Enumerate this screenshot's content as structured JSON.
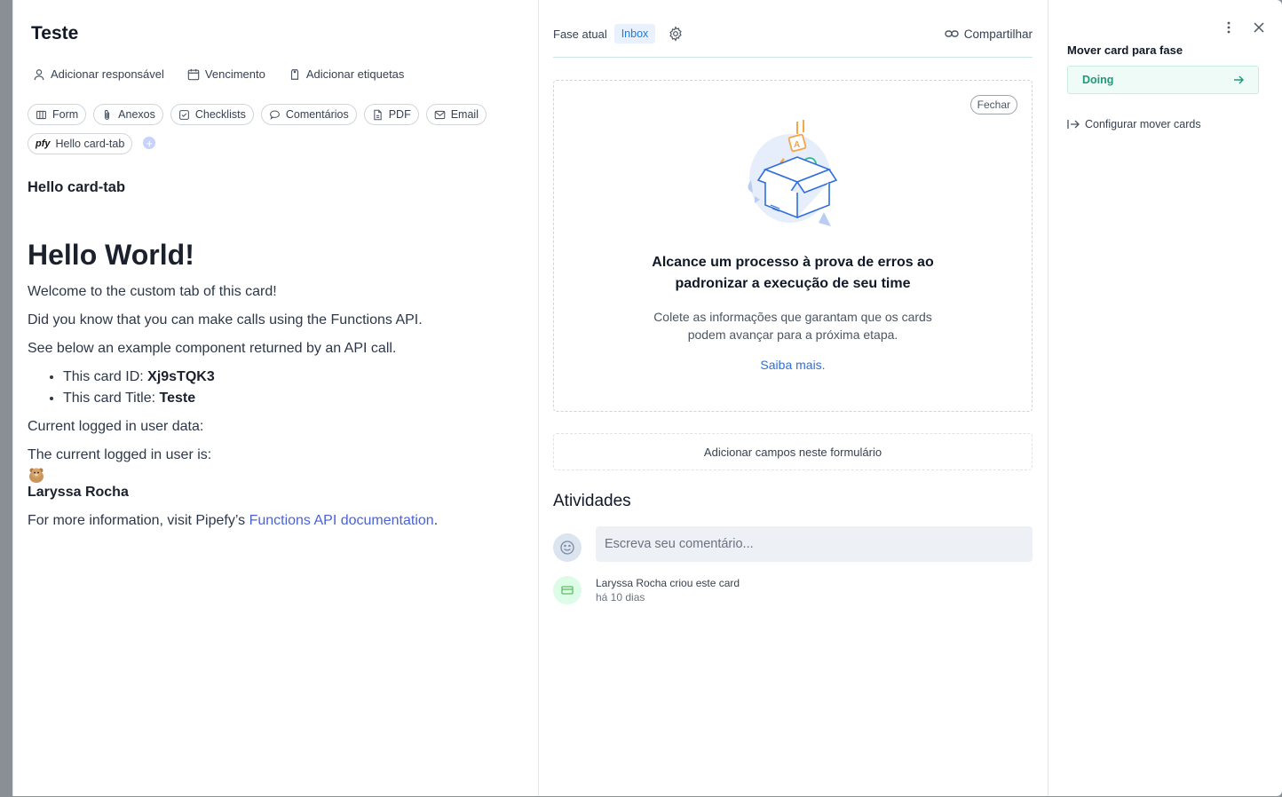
{
  "card": {
    "title": "Teste",
    "actions": {
      "assignee": "Adicionar responsável",
      "due": "Vencimento",
      "labels": "Adicionar etiquetas"
    },
    "tabs": [
      "Form",
      "Anexos",
      "Checklists",
      "Comentários",
      "PDF",
      "Email"
    ],
    "custom_tab": {
      "badge": "pfy",
      "label": "Hello card-tab"
    }
  },
  "custom_content": {
    "heading": "Hello card-tab",
    "title": "Hello World!",
    "p1": "Welcome to the custom tab of this card!",
    "p2": "Did you know that you can make calls using the Functions API.",
    "p3": "See below an example component returned by an API call.",
    "id_label": "This card ID: ",
    "id_value": "Xj9sTQK3",
    "title_label": "This card Title: ",
    "title_value": "Teste",
    "user_data": "Current logged in user data:",
    "current_user": "The current logged in user is:",
    "user_name": "Laryssa Rocha",
    "more_info": "For more information, visit Pipefy’s ",
    "doc_link": "Functions API documentation",
    "period": "."
  },
  "phase": {
    "label": "Fase atual",
    "current": "Inbox",
    "share": "Compartilhar"
  },
  "empty_form": {
    "close": "Fechar",
    "title_line1": "Alcance um processo à prova de erros ao",
    "title_line2": "padronizar a execução de seu time",
    "desc_line1": "Colete as informações que garantam que os cards",
    "desc_line2": "podem avançar para a próxima etapa.",
    "link": "Saiba mais."
  },
  "add_fields": "Adicionar campos neste formulário",
  "activities": {
    "title": "Atividades",
    "comment_placeholder": "Escreva seu comentário...",
    "log_text": "Laryssa Rocha criou este card",
    "log_time": "há 10 dias"
  },
  "move": {
    "title": "Mover card para fase",
    "target": "Doing",
    "config": "Configurar mover cards"
  },
  "colors": {
    "accent": "#1f7ae0",
    "success": "#1e9a78",
    "link": "#4a62d8"
  }
}
